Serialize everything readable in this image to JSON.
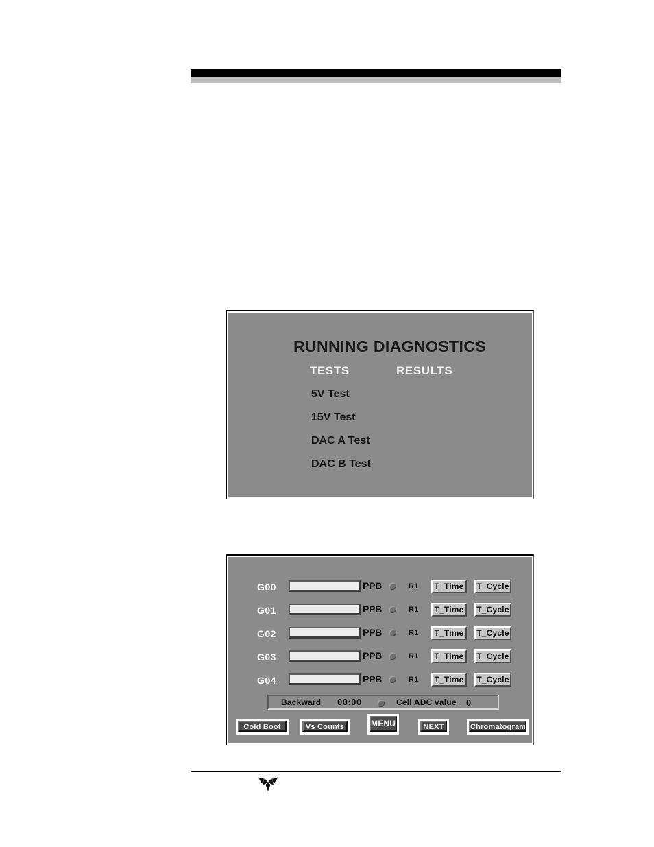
{
  "page": {
    "header_rule_color": "#000000",
    "header_subrule_color": "#bebebe"
  },
  "diagnostics_panel": {
    "title": "RUNNING DIAGNOSTICS",
    "column_headers": {
      "tests": "TESTS",
      "results": "RESULTS"
    },
    "tests": [
      {
        "name": "5V Test",
        "result": ""
      },
      {
        "name": "15V Test",
        "result": ""
      },
      {
        "name": "DAC A Test",
        "result": ""
      },
      {
        "name": "DAC B Test",
        "result": ""
      }
    ]
  },
  "measurement_panel": {
    "rows": [
      {
        "label": "G00",
        "value": "",
        "units": "PPB",
        "range": "R1",
        "t_time": "T_Time",
        "t_cycle": "T_Cycle"
      },
      {
        "label": "G01",
        "value": "",
        "units": "PPB",
        "range": "R1",
        "t_time": "T_Time",
        "t_cycle": "T_Cycle"
      },
      {
        "label": "G02",
        "value": "",
        "units": "PPB",
        "range": "R1",
        "t_time": "T_Time",
        "t_cycle": "T_Cycle"
      },
      {
        "label": "G03",
        "value": "",
        "units": "PPB",
        "range": "R1",
        "t_time": "T_Time",
        "t_cycle": "T_Cycle"
      },
      {
        "label": "G04",
        "value": "",
        "units": "PPB",
        "range": "R1",
        "t_time": "T_Time",
        "t_cycle": "T_Cycle"
      }
    ],
    "status_bar": {
      "direction": "Backward",
      "time": "00:00",
      "adc_label": "Cell ADC value",
      "adc_value": "0"
    },
    "softkeys": [
      {
        "id": "cold-boot",
        "label": "Cold Boot"
      },
      {
        "id": "vs-counts",
        "label": "Vs Counts"
      },
      {
        "id": "menu",
        "label": "MENU"
      },
      {
        "id": "next",
        "label": "NEXT"
      },
      {
        "id": "chromatogram",
        "label": "Chromatogram"
      }
    ]
  },
  "footer": {
    "logo_name": "teledyne-logo"
  }
}
